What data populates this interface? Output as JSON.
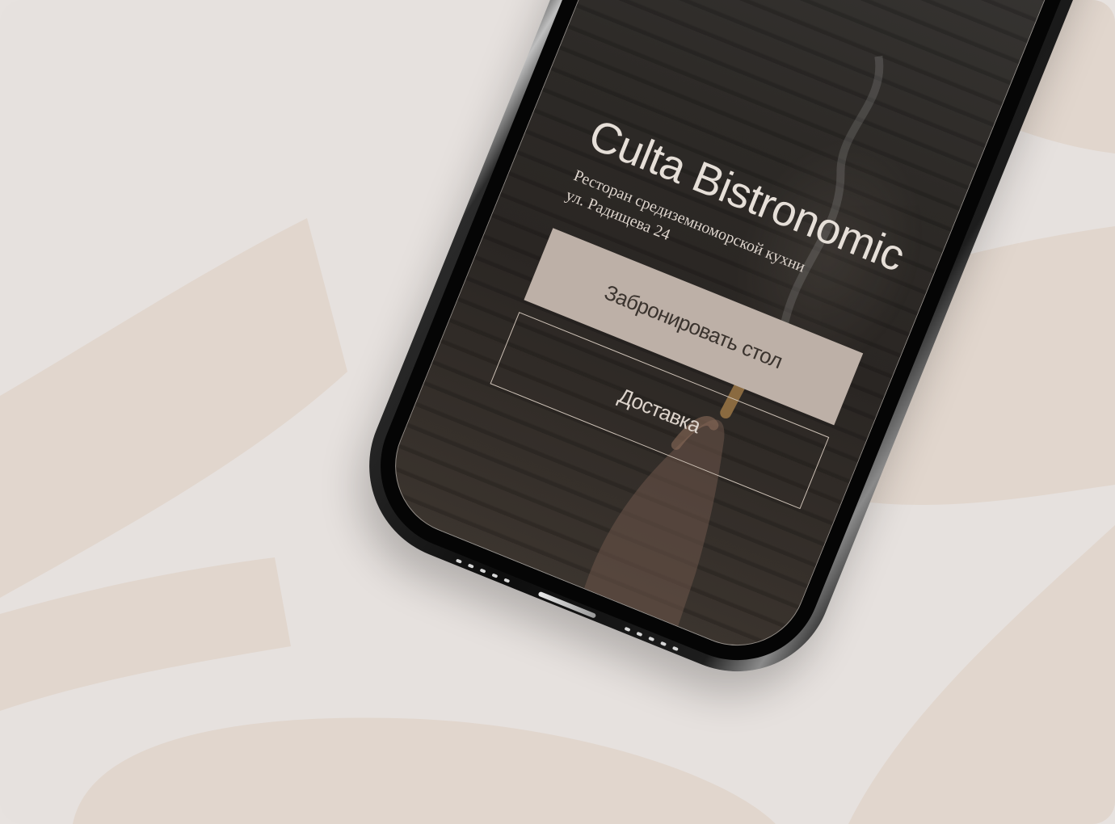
{
  "colors": {
    "background": "#e6e1de",
    "blob": "#e1d6cd",
    "button_primary_bg": "#bdb0a7",
    "button_outline": "#cfc3b8",
    "text_light": "#e6dfd8"
  },
  "restaurant": {
    "title": "Culta Bistronomic",
    "subtitle_line1": "Ресторан средиземноморской кухни",
    "subtitle_line2": "ул. Радищева 24"
  },
  "actions": {
    "book_table_label": "Забронировать стол",
    "delivery_label": "Доставка"
  }
}
